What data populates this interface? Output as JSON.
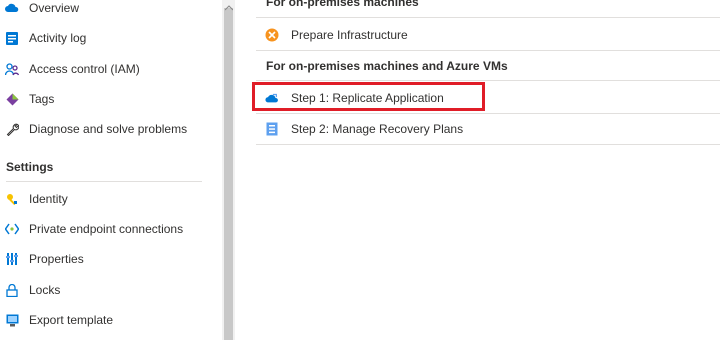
{
  "sidebar": {
    "items": [
      {
        "label": "Overview",
        "icon": "overview-cloud-icon"
      },
      {
        "label": "Activity log",
        "icon": "activity-log-icon"
      },
      {
        "label": "Access control (IAM)",
        "icon": "access-control-icon"
      },
      {
        "label": "Tags",
        "icon": "tag-icon"
      },
      {
        "label": "Diagnose and solve problems",
        "icon": "wrench-icon"
      }
    ],
    "settings_header": "Settings",
    "settings_items": [
      {
        "label": "Identity",
        "icon": "identity-key-icon"
      },
      {
        "label": "Private endpoint connections",
        "icon": "private-endpoint-icon"
      },
      {
        "label": "Properties",
        "icon": "properties-bars-icon"
      },
      {
        "label": "Locks",
        "icon": "lock-icon"
      },
      {
        "label": "Export template",
        "icon": "export-template-icon"
      }
    ]
  },
  "main": {
    "group1_title": "For on-premises machines",
    "group1_items": [
      {
        "label": "Prepare Infrastructure",
        "icon": "prepare-infrastructure-icon"
      }
    ],
    "group2_title": "For on-premises machines and Azure VMs",
    "group2_items": [
      {
        "label": "Step 1: Replicate Application",
        "icon": "replicate-cloud-icon"
      },
      {
        "label": "Step 2: Manage Recovery Plans",
        "icon": "recovery-plans-icon"
      }
    ]
  },
  "colors": {
    "accent_blue": "#0078d4",
    "highlight_red": "#e01d27",
    "warning_orange": "#f7931e"
  }
}
